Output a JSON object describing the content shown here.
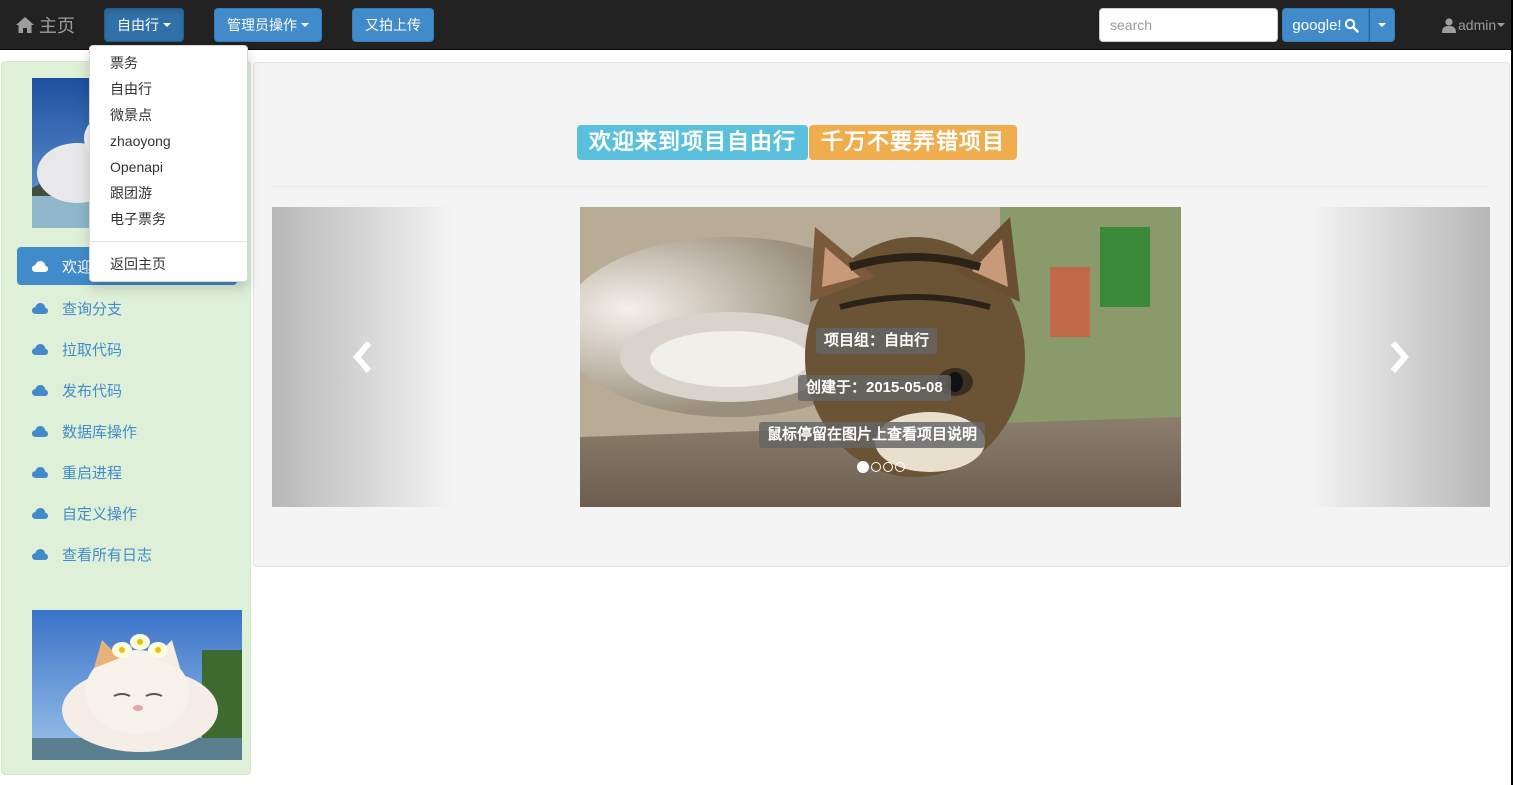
{
  "navbar": {
    "brand_label": "主页",
    "menus": [
      {
        "label": "自由行",
        "active": true
      },
      {
        "label": "管理员操作"
      },
      {
        "label": "又拍上传"
      }
    ],
    "search_placeholder": "search",
    "search_button_label": "google!",
    "user_label": "admin"
  },
  "dropdown": {
    "items": [
      "票务",
      "自由行",
      "微景点",
      "zhaoyong",
      "Openapi",
      "跟团游",
      "电子票务"
    ],
    "footer_item": "返回主页"
  },
  "sidebar": {
    "items": [
      {
        "label": "欢迎",
        "active": true
      },
      {
        "label": "查询分支"
      },
      {
        "label": "拉取代码"
      },
      {
        "label": "发布代码"
      },
      {
        "label": "数据库操作"
      },
      {
        "label": "重启进程"
      },
      {
        "label": "自定义操作"
      },
      {
        "label": "查看所有日志"
      }
    ]
  },
  "main": {
    "welcome_label": "欢迎来到项目自由行",
    "warning_label": "千万不要弄错项目",
    "carousel": {
      "captions": [
        "项目组：自由行",
        "创建于：2015-05-08",
        "鼠标停留在图片上查看项目说明"
      ],
      "slide_count": 4,
      "active_index": 0
    }
  },
  "colors": {
    "navbar_bg": "#222222",
    "primary": "#428bca",
    "sidebar_bg": "#dff0d8",
    "label_info": "#5bc0de",
    "label_warning": "#f0ad4e"
  }
}
